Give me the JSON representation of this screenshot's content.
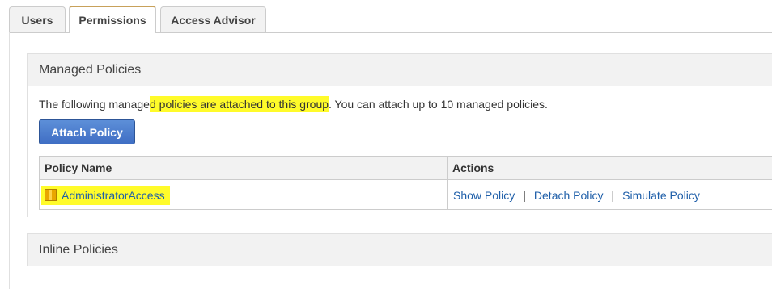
{
  "tabs": [
    {
      "label": "Users",
      "active": false
    },
    {
      "label": "Permissions",
      "active": true
    },
    {
      "label": "Access Advisor",
      "active": false
    }
  ],
  "managed": {
    "title": "Managed Policies",
    "desc_before": "The following manage",
    "desc_highlight": "d policies are attached to this group",
    "desc_after": ". You can attach up to 10 managed policies.",
    "attach_button": "Attach Policy",
    "table": {
      "columns": [
        "Policy Name",
        "Actions"
      ],
      "rows": [
        {
          "name": "AdministratorAccess",
          "icon": "policy-box-icon",
          "actions": [
            "Show Policy",
            "Detach Policy",
            "Simulate Policy"
          ],
          "separator": "|"
        }
      ]
    }
  },
  "inline": {
    "title": "Inline Policies"
  },
  "colors": {
    "highlight": "#fffb2a",
    "link": "#1f5fa9",
    "button": "#3f6ec4",
    "active_tab_accent": "#c8a15a"
  }
}
